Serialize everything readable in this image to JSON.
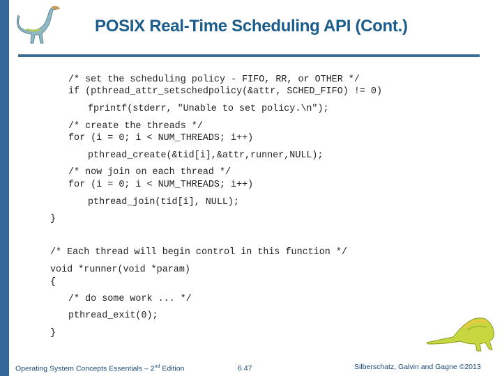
{
  "slide": {
    "title": "POSIX Real-Time Scheduling API (Cont.)",
    "code_lines": [
      "/* set the scheduling policy - FIFO, RR, or OTHER */",
      "if (pthread_attr_setschedpolicy(&attr, SCHED_FIFO) != 0)",
      "fprintf(stderr, \"Unable to set policy.\\n\");",
      "/* create the threads */",
      "for (i = 0; i < NUM_THREADS; i++)",
      "pthread_create(&tid[i],&attr,runner,NULL);",
      "/* now join on each thread */",
      "for (i = 0; i < NUM_THREADS; i++)",
      "pthread_join(tid[i], NULL);",
      "}",
      "/* Each thread will begin control in this function */",
      "void *runner(void *param)",
      "{",
      "/* do some work ... */",
      "pthread_exit(0);",
      "}"
    ]
  },
  "footer": {
    "book_title_prefix": "Operating System Concepts Essentials – 2",
    "book_title_sup": "nd",
    "book_title_suffix": " Edition",
    "page_number": "6.47",
    "copyright": "Silberschatz, Galvin and Gagne ©2013"
  }
}
